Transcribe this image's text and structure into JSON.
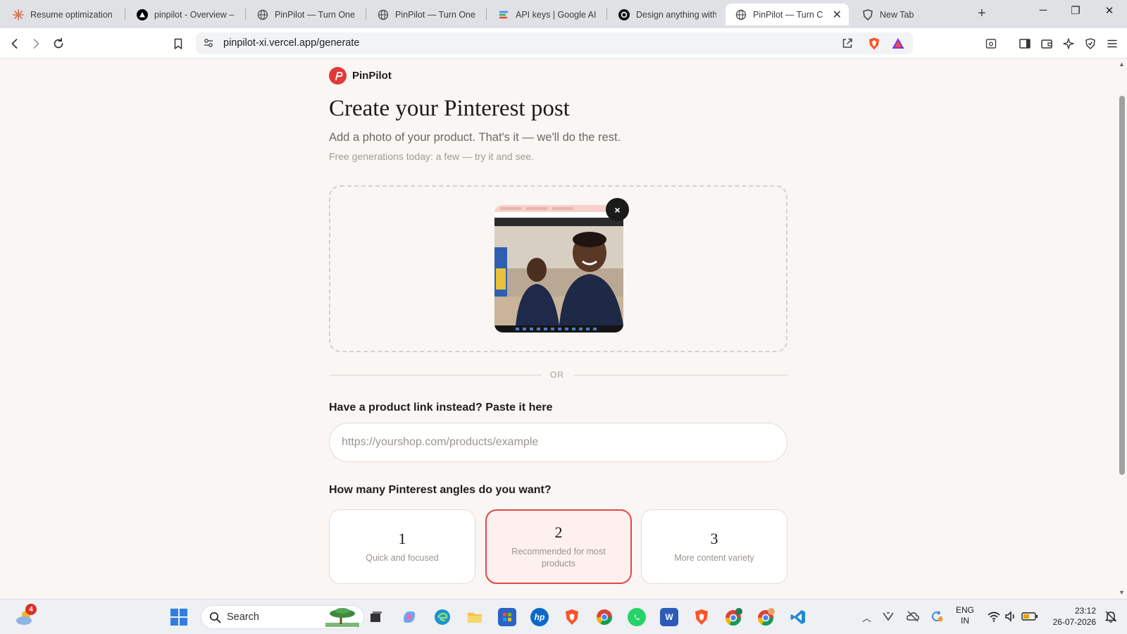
{
  "browser": {
    "tabs": [
      {
        "label": "Resume optimization",
        "icon": "claude-icon"
      },
      {
        "label": "pinpilot - Overview – V",
        "icon": "vercel-icon"
      },
      {
        "label": "PinPilot — Turn One P",
        "icon": "globe-icon"
      },
      {
        "label": "PinPilot — Turn One P",
        "icon": "globe-icon"
      },
      {
        "label": "API keys | Google AI S",
        "icon": "google-ai-studio-icon"
      },
      {
        "label": "Design anything with",
        "icon": "design-tool-icon"
      },
      {
        "label": "PinPilot — Turn C",
        "icon": "globe-icon",
        "active": true
      },
      {
        "label": "New Tab",
        "icon": "brave-shield-icon"
      }
    ],
    "url": "pinpilot-xi.vercel.app/generate"
  },
  "page": {
    "brand_name": "PinPilot",
    "title": "Create your Pinterest post",
    "subtitle": "Add a photo of your product. That's it — we'll do the rest.",
    "free_line": "Free generations today: a few — try it and see.",
    "remove_label": "×",
    "or_label": "OR",
    "link_label": "Have a product link instead? Paste it here",
    "link_placeholder": "https://yourshop.com/products/example",
    "link_value": "",
    "angles_label": "How many Pinterest angles do you want?",
    "angles": [
      {
        "number": "1",
        "desc": "Quick and focused",
        "selected": false
      },
      {
        "number": "2",
        "desc": "Recommended for most products",
        "selected": true
      },
      {
        "number": "3",
        "desc": "More content variety",
        "selected": false
      }
    ],
    "accent_color": "#e03a3a"
  },
  "taskbar": {
    "weather_badge": "4",
    "search_label": "Search",
    "lang_top": "ENG",
    "lang_bottom": "IN",
    "time": "23:12",
    "date": "26-07-2026"
  }
}
